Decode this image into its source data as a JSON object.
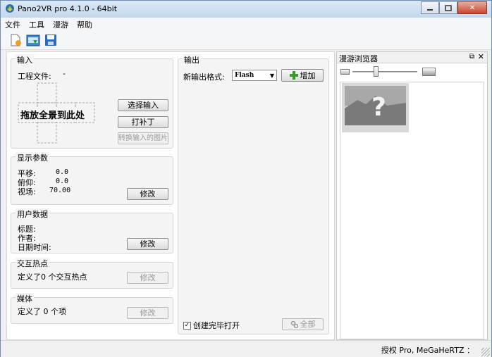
{
  "window": {
    "title": "Pano2VR pro 4.1.0 - 64bit",
    "minimize_icon": "minimize-icon",
    "maximize_icon": "maximize-icon",
    "close_icon": "close-icon"
  },
  "menu": {
    "items": [
      "文件",
      "工具",
      "漫游",
      "帮助"
    ]
  },
  "toolbar": {
    "icons": [
      "new-project-icon",
      "open-project-icon",
      "save-icon"
    ]
  },
  "input": {
    "title": "输入",
    "project_file_label": "工程文件:",
    "project_file_value": "-",
    "drop_text": "拖放全景到此处",
    "select_input_button": "选择输入",
    "patch_button": "打补丁",
    "convert_button": "转换输入的图片"
  },
  "display": {
    "title": "显示参数",
    "pan_label": "平移:",
    "pan_value": "0.0",
    "tilt_label": "俯仰:",
    "tilt_value": "0.0",
    "fov_label": "视场:",
    "fov_value": "70.00",
    "modify_button": "修改"
  },
  "userdata": {
    "title": "用户数据",
    "title_label": "标题:",
    "author_label": "作者:",
    "datetime_label": "日期时间:",
    "modify_button": "修改"
  },
  "hotspots": {
    "title": "交互热点",
    "text": "定义了0 个交互热点",
    "modify_button": "修改"
  },
  "media": {
    "title": "媒体",
    "text": "定义了 0 个项",
    "modify_button": "修改"
  },
  "output": {
    "title": "输出",
    "new_format_label": "新输出格式:",
    "format_selected": "Flash",
    "add_button": "增加",
    "open_when_done_label": "创建完毕打开",
    "open_when_done_checked": true,
    "all_button": "全部"
  },
  "tour_browser": {
    "title": "漫游浏览器"
  },
  "status": {
    "license": "授权 Pro, MeGaHeRTZ ："
  },
  "colors": {
    "title_gradient_top": "#dbe8f5",
    "close_button": "#c9462c",
    "add_icon_green": "#3a9a2a"
  }
}
